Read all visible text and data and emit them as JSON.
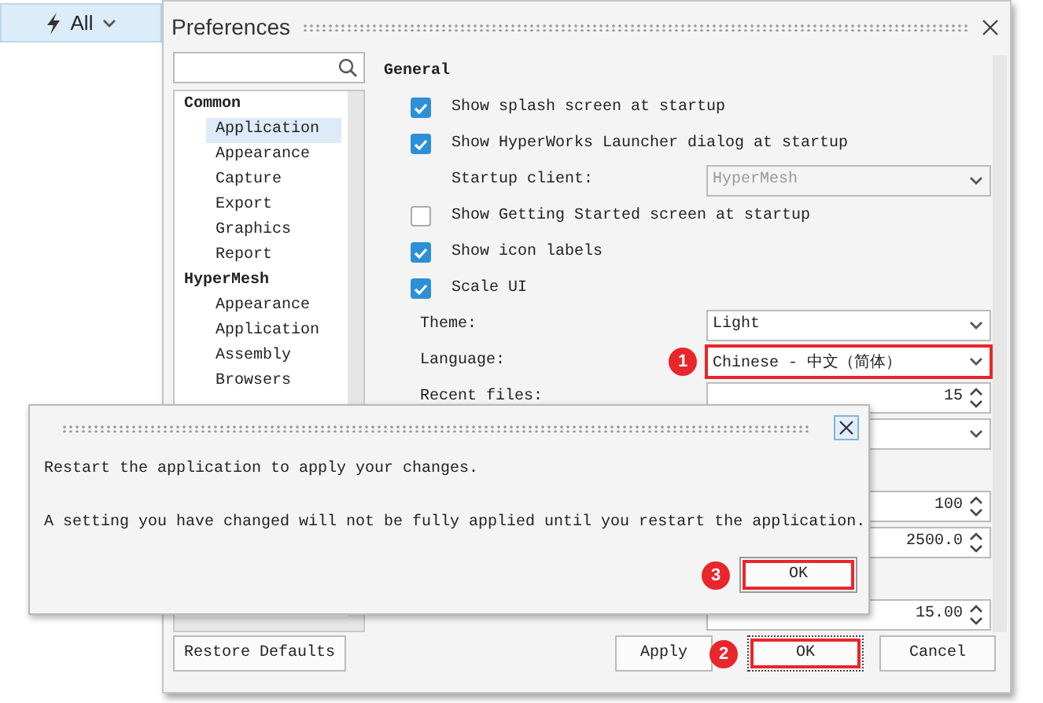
{
  "filter": {
    "label": "All"
  },
  "window": {
    "title": "Preferences"
  },
  "tree": [
    {
      "label": "Common",
      "children": [
        {
          "label": "Application",
          "selected": true
        },
        {
          "label": "Appearance",
          "selected": false
        },
        {
          "label": "Capture",
          "selected": false
        },
        {
          "label": "Export",
          "selected": false
        },
        {
          "label": "Graphics",
          "selected": false
        },
        {
          "label": "Report",
          "selected": false
        }
      ]
    },
    {
      "label": "HyperMesh",
      "children": [
        {
          "label": "Appearance",
          "selected": false
        },
        {
          "label": "Application",
          "selected": false
        },
        {
          "label": "Assembly",
          "selected": false
        },
        {
          "label": "Browsers",
          "selected": false
        }
      ]
    }
  ],
  "section": "General",
  "settings": [
    {
      "kind": "checkbox",
      "label": "Show splash screen at startup",
      "checked": true
    },
    {
      "kind": "checkbox",
      "label": "Show HyperWorks Launcher dialog at startup",
      "checked": true
    },
    {
      "kind": "sub-dropdown",
      "label": "Startup client:",
      "value": "HyperMesh",
      "disabled": true
    },
    {
      "kind": "checkbox",
      "label": "Show Getting Started screen at startup",
      "checked": false
    },
    {
      "kind": "checkbox",
      "label": "Show icon labels",
      "checked": true
    },
    {
      "kind": "checkbox",
      "label": "Scale UI",
      "checked": true
    },
    {
      "kind": "dropdown",
      "label": "Theme:",
      "value": "Light"
    },
    {
      "kind": "dropdown",
      "label": "Language:",
      "value": "Chinese - 中文（简体）",
      "annotation": "1"
    },
    {
      "kind": "spinbox",
      "label": "Recent files:",
      "value": "15"
    },
    {
      "kind": "dropdown"
    },
    {
      "kind": "covered"
    },
    {
      "kind": "spinbox",
      "value": "100"
    },
    {
      "kind": "spinbox",
      "value": "2500.0"
    },
    {
      "kind": "covered"
    },
    {
      "kind": "spinbox",
      "value": "15.00"
    }
  ],
  "restore_button": "Restore Defaults",
  "buttons": [
    {
      "label": "Apply",
      "focused": false
    },
    {
      "label": "OK",
      "focused": true,
      "annotation": "2"
    },
    {
      "label": "Cancel",
      "focused": false
    }
  ],
  "message": {
    "lines": [
      "Restart the application to apply your changes.",
      "A setting you have changed will not be fully applied until you restart the application."
    ],
    "button": {
      "label": "OK",
      "annotation": "3"
    }
  }
}
